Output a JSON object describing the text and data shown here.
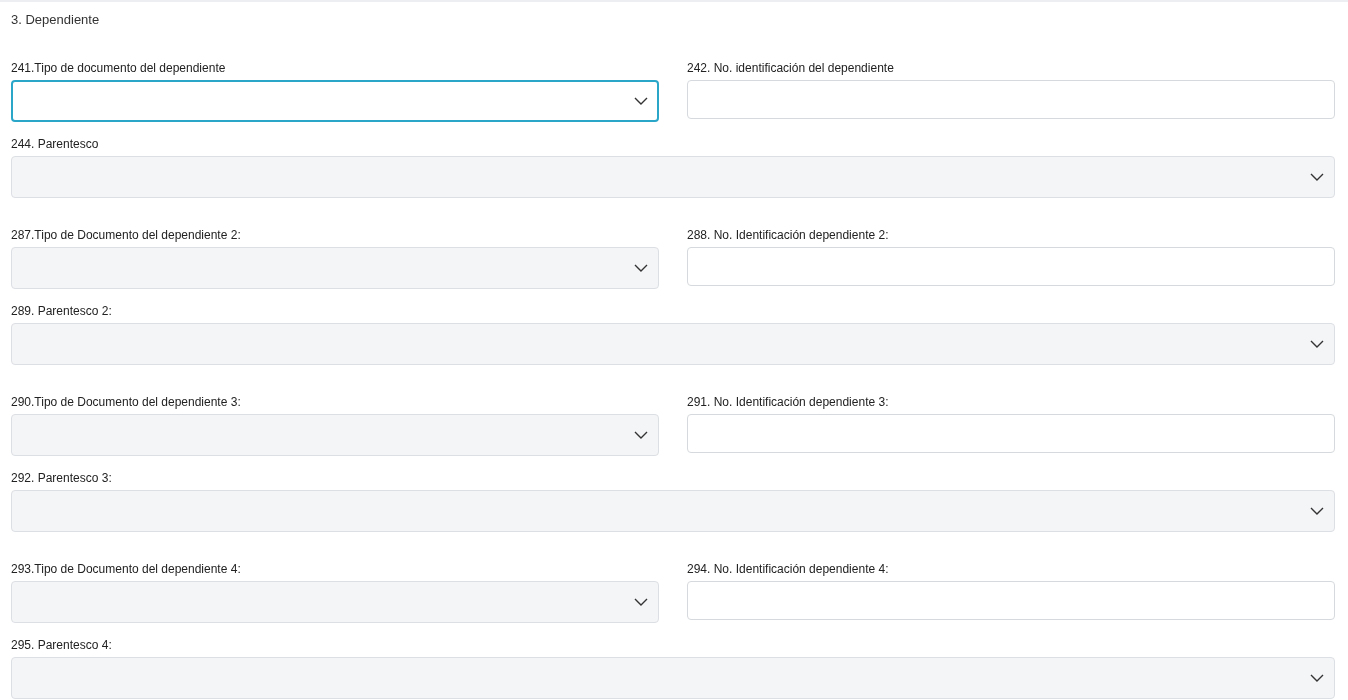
{
  "section_title": "3. Dependiente",
  "dependents": [
    {
      "document_type": {
        "label": "241.Tipo de documento del dependiente",
        "focused": true
      },
      "id_number": {
        "label": "242. No. identificación del dependiente"
      },
      "relationship": {
        "label": "244. Parentesco",
        "focused": false
      }
    },
    {
      "document_type": {
        "label": "287.Tipo de Documento del dependiente 2:",
        "focused": false
      },
      "id_number": {
        "label": "288. No. Identificación dependiente 2:"
      },
      "relationship": {
        "label": "289. Parentesco 2:",
        "focused": false
      }
    },
    {
      "document_type": {
        "label": "290.Tipo de Documento del dependiente 3:",
        "focused": false
      },
      "id_number": {
        "label": "291. No. Identificación dependiente 3:"
      },
      "relationship": {
        "label": "292. Parentesco 3:",
        "focused": false
      }
    },
    {
      "document_type": {
        "label": "293.Tipo de Documento del dependiente 4:",
        "focused": false
      },
      "id_number": {
        "label": "294. No. Identificación dependiente 4:"
      },
      "relationship": {
        "label": "295. Parentesco 4:",
        "focused": false
      }
    }
  ]
}
